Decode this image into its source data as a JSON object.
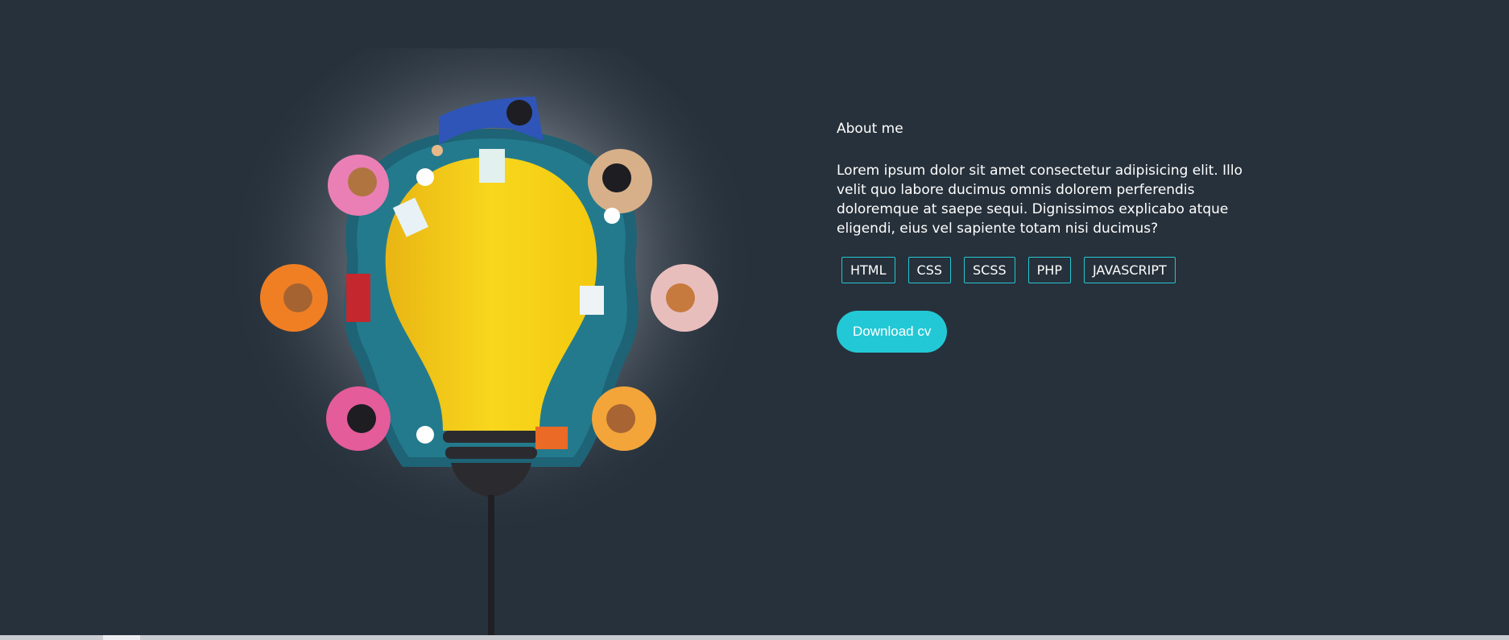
{
  "about": {
    "title": "About me",
    "text": "Lorem ipsum dolor sit amet consectetur adipisicing elit. Illo velit quo labore ducimus omnis dolorem perferendis doloremque at saepe sequi. Dignissimos explicabo atque eligendi, eius vel sapiente totam nisi ducimus?",
    "skills": [
      "HTML",
      "CSS",
      "SCSS",
      "PHP",
      "JAVASCRIPT"
    ],
    "download_label": "Download cv"
  },
  "illustration": {
    "icon": "lightbulb-team-meeting-illustration"
  },
  "colors": {
    "background": "#27313b",
    "accent": "#23c8d6",
    "bulb": "#f5cf18",
    "table": "#1f6b80"
  }
}
